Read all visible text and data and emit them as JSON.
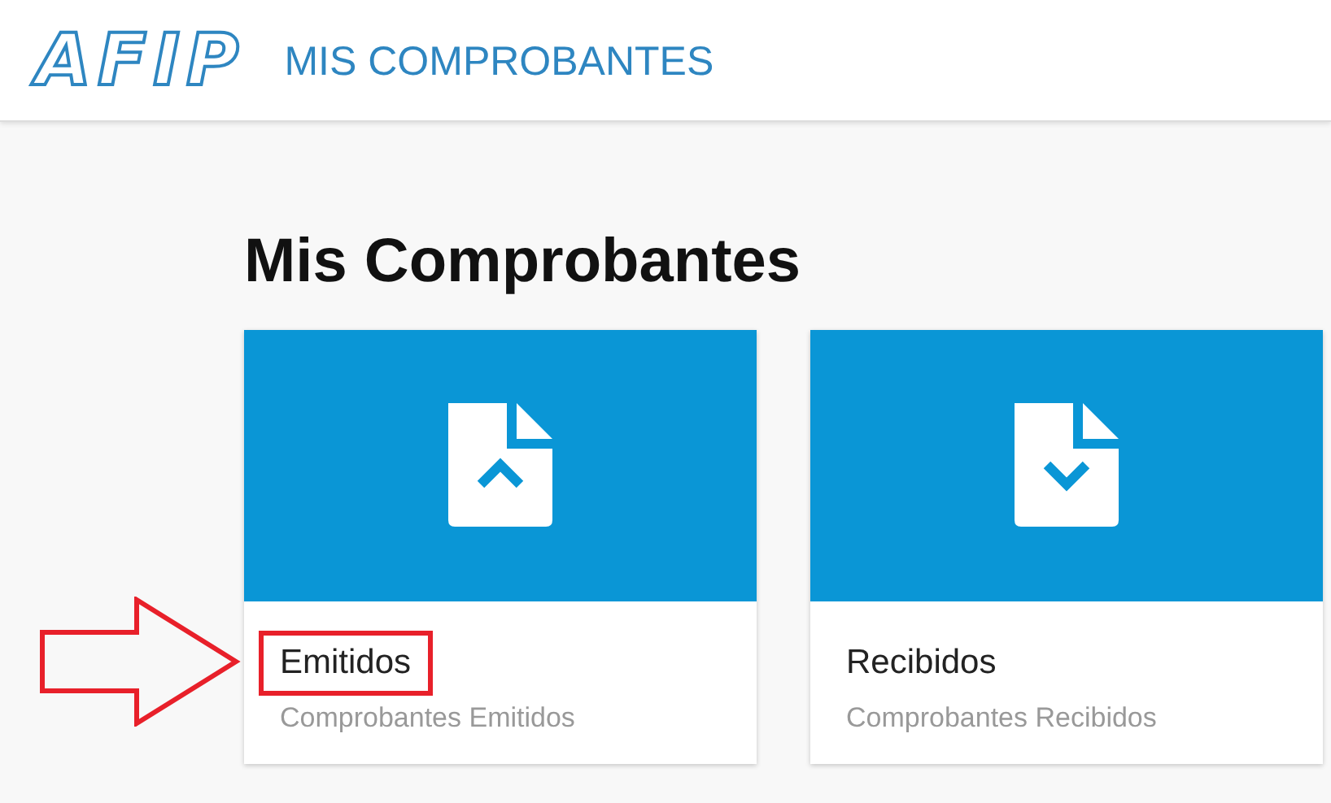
{
  "header": {
    "logo": "AFIP",
    "title": "MIS COMPROBANTES"
  },
  "heading": "Mis Comprobantes",
  "cards": [
    {
      "kind": "upload",
      "title": "Emitidos",
      "subtitle": "Comprobantes Emitidos",
      "highlighted": true
    },
    {
      "kind": "download",
      "title": "Recibidos",
      "subtitle": "Comprobantes Recibidos",
      "highlighted": false
    }
  ]
}
